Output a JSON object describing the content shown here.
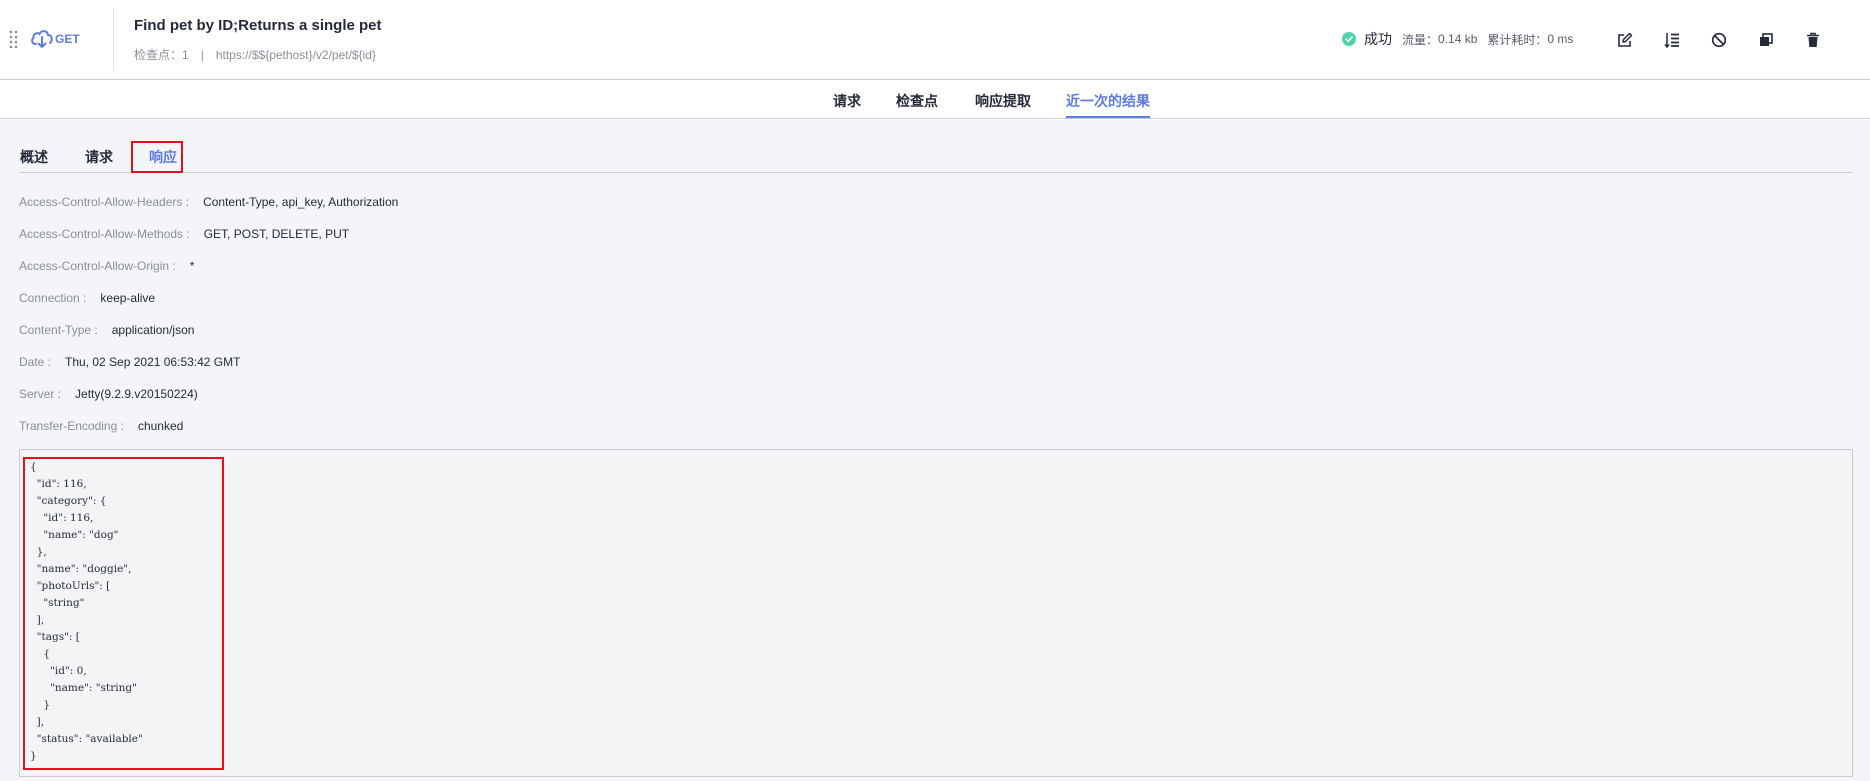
{
  "case": {
    "method": "GET",
    "title": "Find pet by ID;Returns a single pet",
    "checkpoints_label": "检查点：",
    "checkpoints_count": "1",
    "separator": "|",
    "url": "https://$${pethost}/v2/pet/${id}"
  },
  "status": {
    "result": "成功",
    "traffic_label": "流量：",
    "traffic_value": "0.14 kb",
    "time_label": "累计耗时：",
    "time_value": "0 ms",
    "success_color": "#50d4ab"
  },
  "toolbar_icons": [
    "edit-icon",
    "list-order-icon",
    "disable-icon",
    "copy-icon",
    "delete-icon"
  ],
  "main_tabs": [
    {
      "label": "请求",
      "active": false
    },
    {
      "label": "检查点",
      "active": false
    },
    {
      "label": "响应提取",
      "active": false
    },
    {
      "label": "近一次的结果",
      "active": true
    }
  ],
  "sub_tabs": [
    {
      "label": "概述",
      "active": false
    },
    {
      "label": "请求",
      "active": false
    },
    {
      "label": "响应",
      "active": true
    }
  ],
  "response_headers": [
    {
      "key": "Access-Control-Allow-Headers :",
      "value": "Content-Type, api_key, Authorization"
    },
    {
      "key": "Access-Control-Allow-Methods :",
      "value": "GET, POST, DELETE, PUT"
    },
    {
      "key": "Access-Control-Allow-Origin :",
      "value": "*"
    },
    {
      "key": "Connection :",
      "value": "keep-alive"
    },
    {
      "key": "Content-Type :",
      "value": "application/json"
    },
    {
      "key": "Date :",
      "value": "Thu, 02 Sep 2021 06:53:42 GMT"
    },
    {
      "key": "Server :",
      "value": "Jetty(9.2.9.v20150224)"
    },
    {
      "key": "Transfer-Encoding :",
      "value": "chunked"
    }
  ],
  "response_body": "{\n  \"id\": 116,\n  \"category\": {\n    \"id\": 116,\n    \"name\": \"dog\"\n  },\n  \"name\": \"doggie\",\n  \"photoUrls\": [\n    \"string\"\n  ],\n  \"tags\": [\n    {\n      \"id\": 0,\n      \"name\": \"string\"\n    }\n  ],\n  \"status\": \"available\"\n}",
  "colors": {
    "accent": "#5e7ce0",
    "highlight": "#e4101d",
    "background": "#f3f5f8"
  }
}
